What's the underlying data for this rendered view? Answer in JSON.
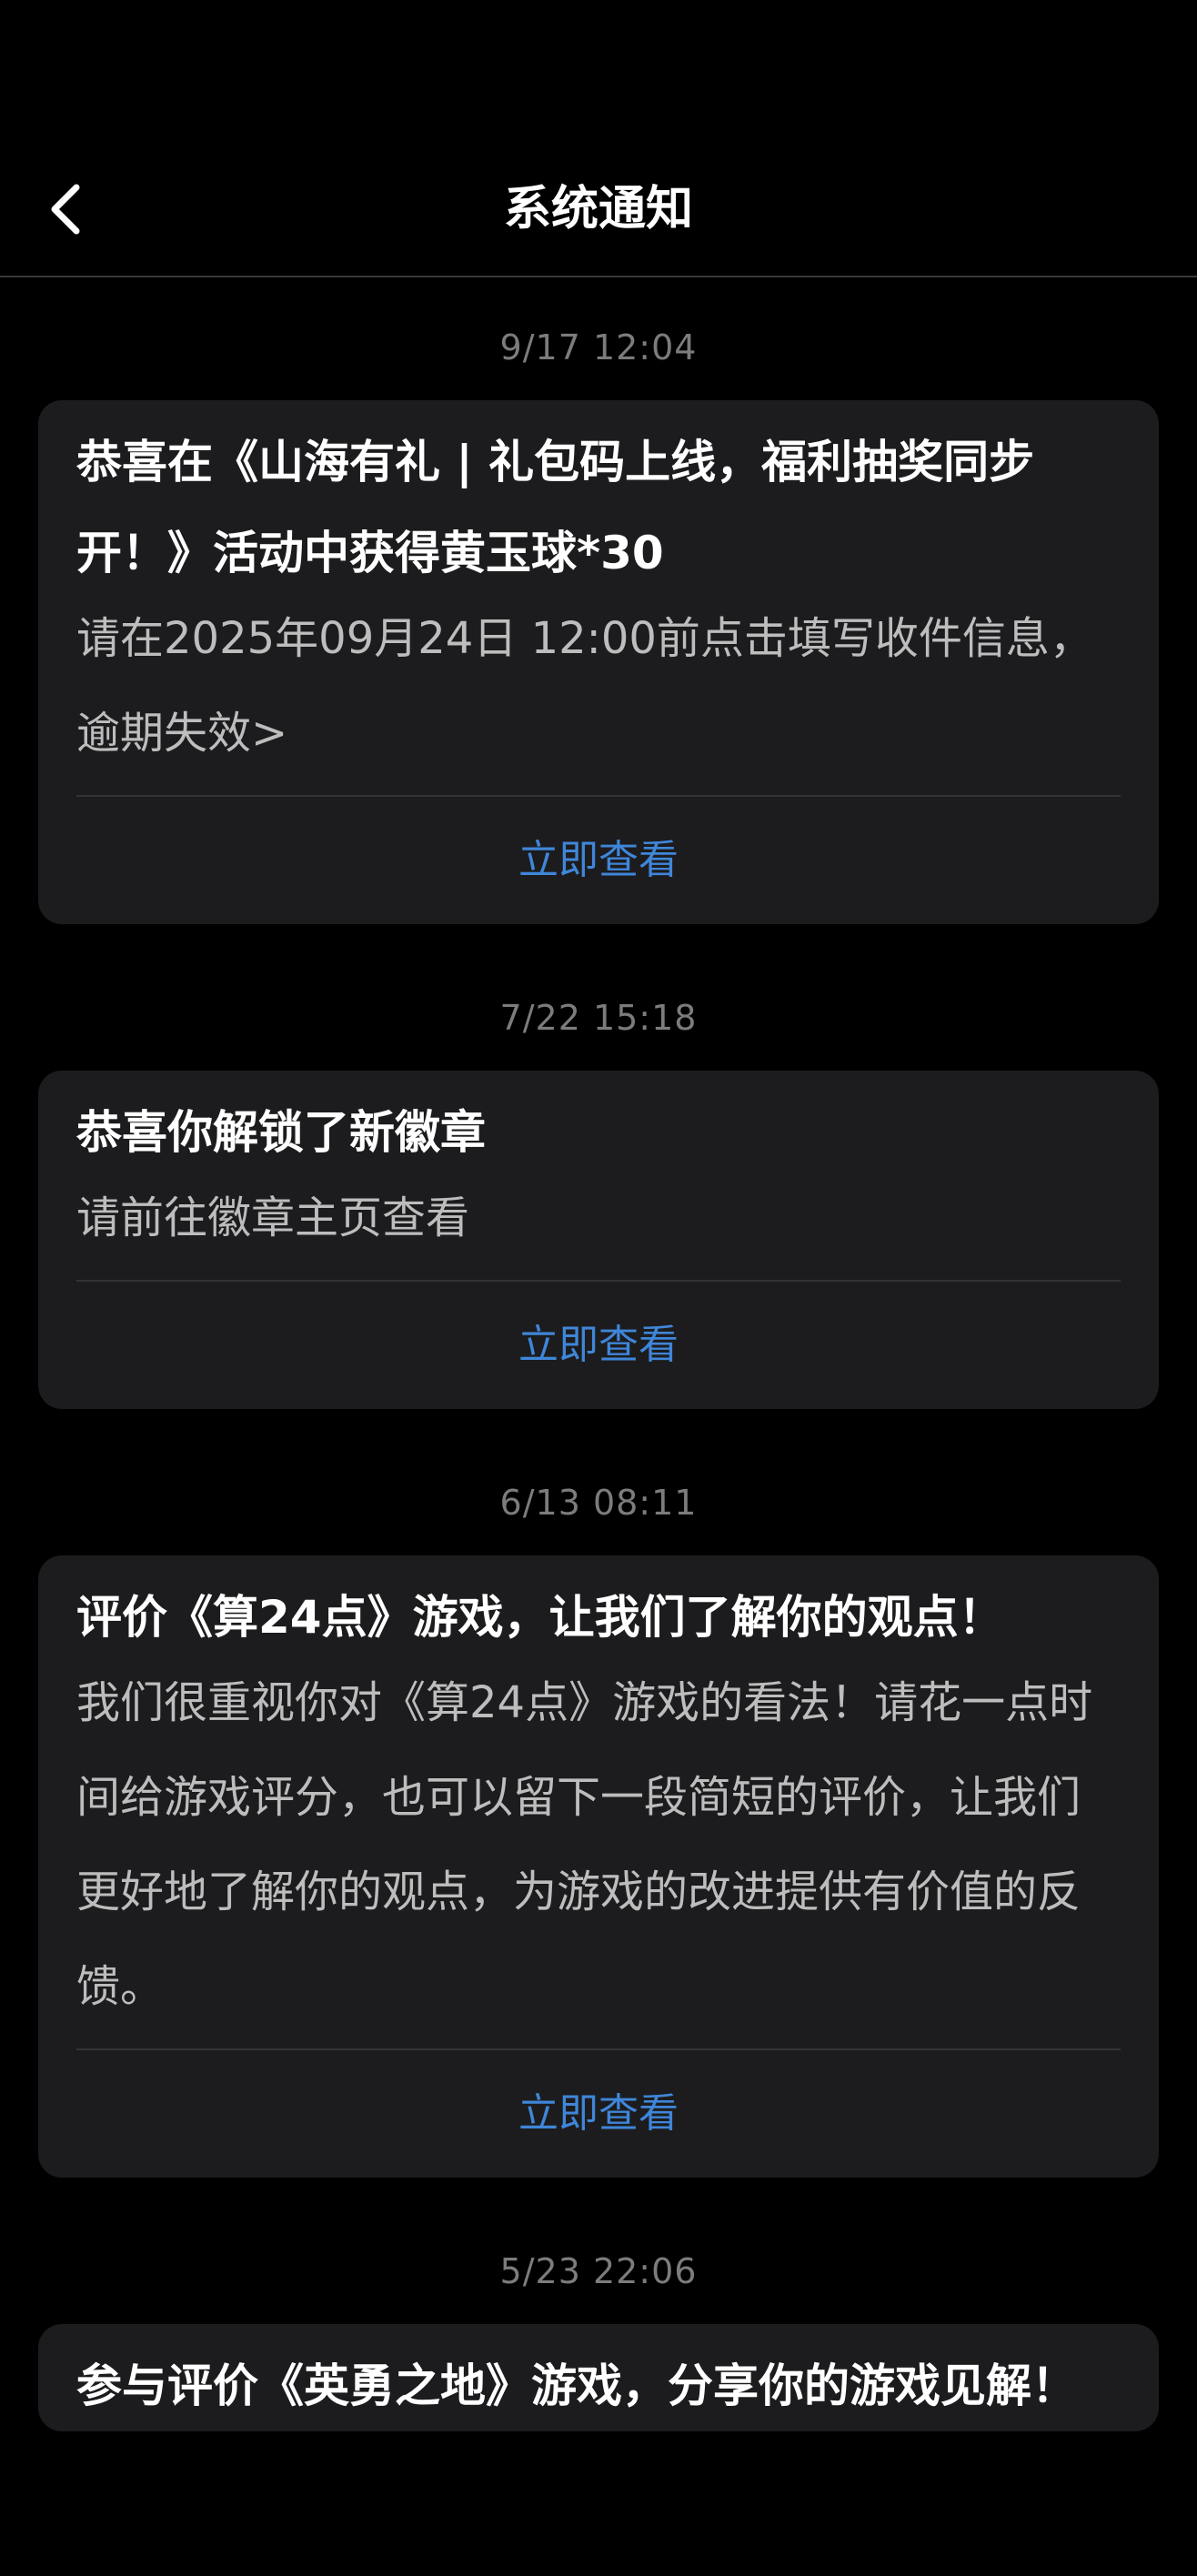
{
  "header": {
    "title": "系统通知",
    "back_icon": "chevron-left-icon"
  },
  "notifications": [
    {
      "time": "9/17  12:04",
      "title": "恭喜在《山海有礼 | 礼包码上线，福利抽奖同步开！》活动中获得黄玉球*30",
      "body": "请在2025年09月24日 12:00前点击填写收件信息，逾期失效>",
      "action": "立即查看"
    },
    {
      "time": "7/22  15:18",
      "title": "恭喜你解锁了新徽章",
      "body": "请前往徽章主页查看",
      "action": "立即查看"
    },
    {
      "time": "6/13  08:11",
      "title": "评价《算24点》游戏，让我们了解你的观点！",
      "body": "我们很重视你对《算24点》游戏的看法！请花一点时间给游戏评分，也可以留下一段简短的评价，让我们更好地了解你的观点，为游戏的改进提供有价值的反馈。",
      "action": "立即查看"
    },
    {
      "time": "5/23  22:06",
      "title": "参与评价《英勇之地》游戏，分享你的游戏见解！"
    }
  ],
  "colors": {
    "background": "#000000",
    "card": "#1c1c1e",
    "action": "#3f86d9",
    "timestamp": "#7c7c7c"
  }
}
